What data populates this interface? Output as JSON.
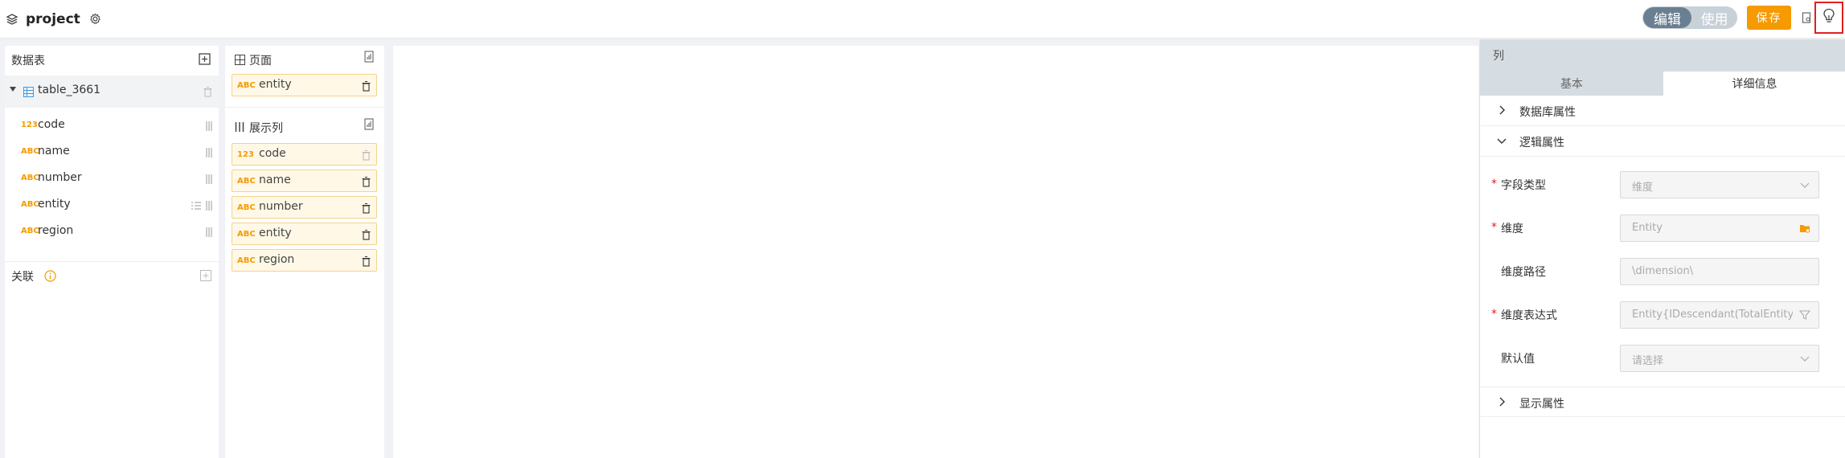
{
  "header": {
    "project_name": "project",
    "mode_edit": "编辑",
    "mode_use": "使用",
    "save_label": "保存"
  },
  "left": {
    "title": "数据表",
    "table_name": "table_3661",
    "fields": [
      {
        "type": "123",
        "name": "code"
      },
      {
        "type": "ABC",
        "name": "name"
      },
      {
        "type": "ABC",
        "name": "number"
      },
      {
        "type": "ABC",
        "name": "entity"
      },
      {
        "type": "ABC",
        "name": "region"
      }
    ],
    "relation_title": "关联"
  },
  "middle": {
    "page_title": "页面",
    "page_items": [
      {
        "type": "ABC",
        "name": "entity"
      }
    ],
    "columns_title": "展示列",
    "column_items": [
      {
        "type": "123",
        "name": "code"
      },
      {
        "type": "ABC",
        "name": "name"
      },
      {
        "type": "ABC",
        "name": "number"
      },
      {
        "type": "ABC",
        "name": "entity"
      },
      {
        "type": "ABC",
        "name": "region"
      }
    ]
  },
  "props": {
    "title": "列",
    "tab_basic": "基本",
    "tab_detail": "详细信息",
    "section_db": "数据库属性",
    "section_logic": "逻辑属性",
    "section_display": "显示属性",
    "rows": [
      {
        "label": "字段类型",
        "required": "*",
        "value": "维度"
      },
      {
        "label": "维度",
        "required": "*",
        "value": "Entity"
      },
      {
        "label": "维度路径",
        "required": "",
        "value": "\\dimension\\"
      },
      {
        "label": "维度表达式",
        "required": "*",
        "value": "Entity{IDescendant(TotalEntity"
      },
      {
        "label": "默认值",
        "required": "",
        "value": "请选择"
      }
    ]
  },
  "colors": {
    "accent": "#f59a00",
    "required": "#e02020",
    "toggle_active": "#6b7f92"
  }
}
